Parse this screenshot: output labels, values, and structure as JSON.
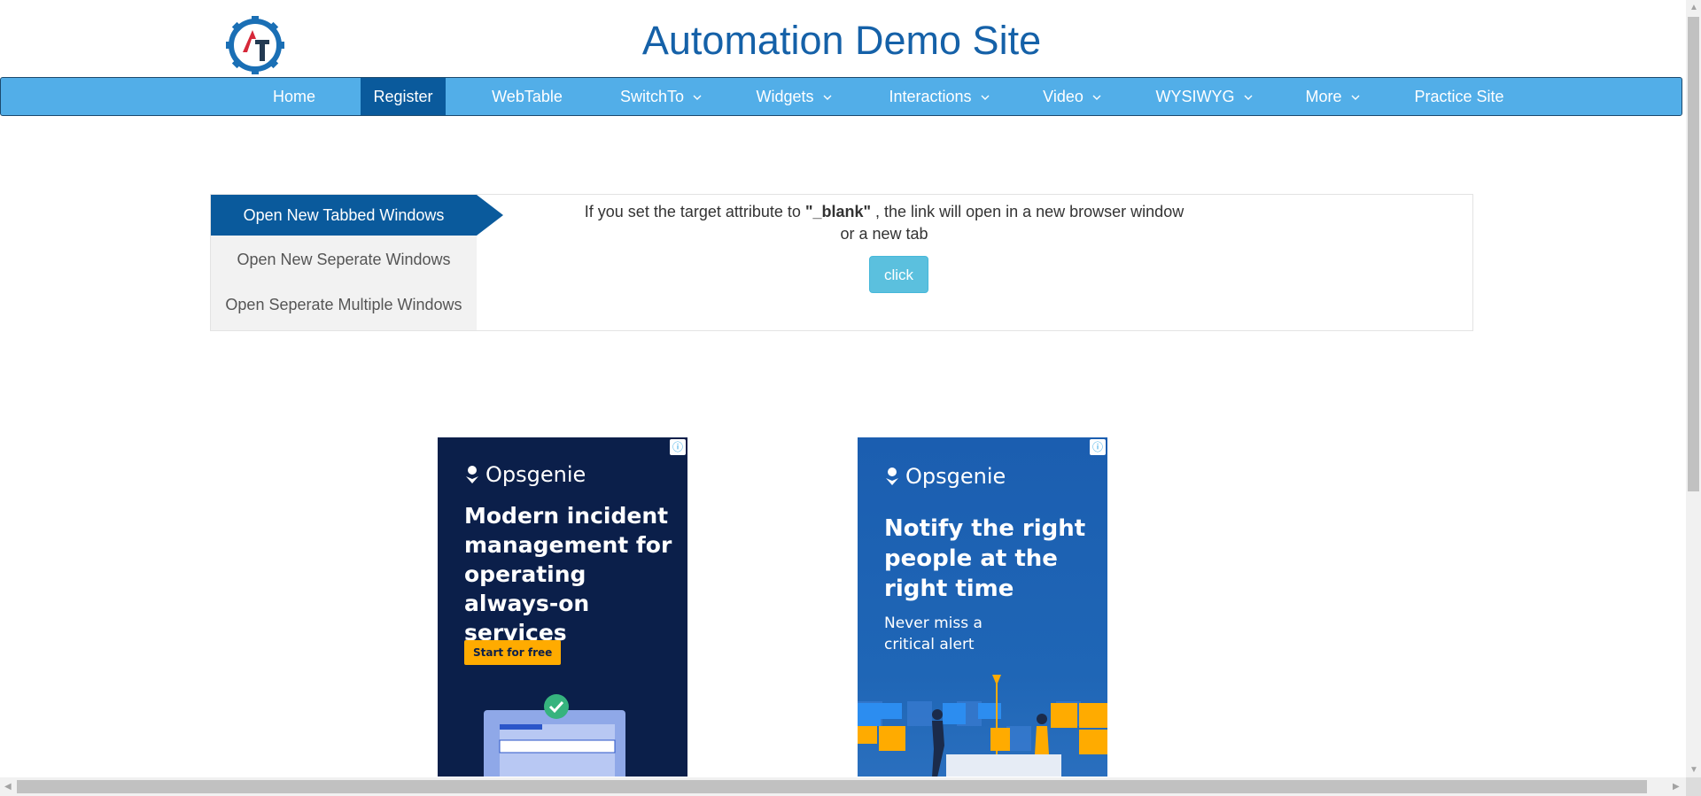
{
  "header": {
    "title": "Automation Demo Site",
    "logo_text": "AT"
  },
  "nav": {
    "items": [
      {
        "label": "Home",
        "dropdown": false
      },
      {
        "label": "Register",
        "dropdown": false,
        "active": true
      },
      {
        "label": "WebTable",
        "dropdown": false
      },
      {
        "label": "SwitchTo",
        "dropdown": true
      },
      {
        "label": "Widgets",
        "dropdown": true
      },
      {
        "label": "Interactions",
        "dropdown": true
      },
      {
        "label": "Video",
        "dropdown": true
      },
      {
        "label": "WYSIWYG",
        "dropdown": true
      },
      {
        "label": "More",
        "dropdown": true
      },
      {
        "label": "Practice Site",
        "dropdown": false
      }
    ]
  },
  "tabs": {
    "items": [
      {
        "label": "Open New Tabbed Windows",
        "active": true
      },
      {
        "label": "Open New Seperate Windows"
      },
      {
        "label": "Open Seperate Multiple Windows"
      }
    ]
  },
  "content": {
    "desc_pre": "If you set the target attribute to ",
    "desc_bold": "\"_blank\"",
    "desc_post": " , the link will open in a new browser window",
    "desc_line2": "or a new tab",
    "button": "click"
  },
  "ads": [
    {
      "brand": "Opsgenie",
      "headline": "Modern incident management for operating always-on services",
      "cta": "Start for free",
      "bg": "#0b1f4a"
    },
    {
      "brand": "Opsgenie",
      "headline": "Notify the right people at the right time",
      "sub": "Never miss a critical alert",
      "bg": "#1b5eb0"
    }
  ],
  "colors": {
    "title": "#1561a8",
    "navbar": "#52aee8",
    "active": "#0a5a9c",
    "button": "#5bc0de"
  },
  "icons": {
    "ad_info": "info-icon",
    "nav_dropdown": "chevron-down-icon"
  }
}
